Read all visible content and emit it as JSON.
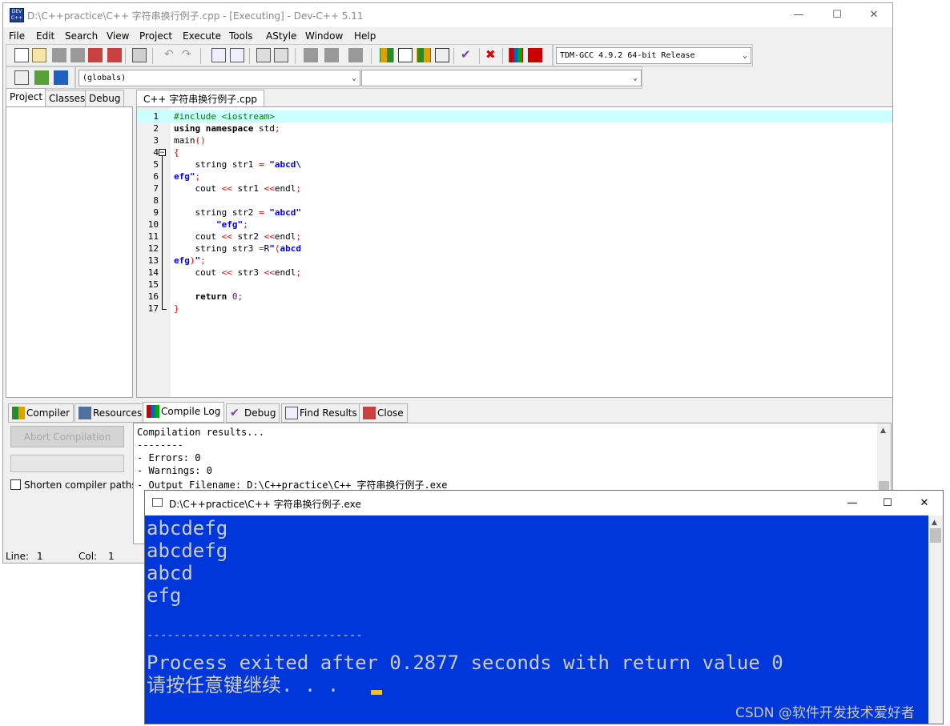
{
  "ide": {
    "title": "D:\\C++practice\\C++ 字符串换行例子.cpp - [Executing] - Dev-C++ 5.11",
    "menu": [
      "File",
      "Edit",
      "Search",
      "View",
      "Project",
      "Execute",
      "Tools",
      "AStyle",
      "Window",
      "Help"
    ],
    "compiler_select": "TDM-GCC 4.9.2 64-bit Release",
    "scope_select": "(globals)",
    "left_tabs": [
      "Project",
      "Classes",
      "Debug"
    ],
    "editor_tab": "C++ 字符串换行例子.cpp",
    "line_numbers": [
      "1",
      "2",
      "3",
      "4",
      "5",
      "6",
      "7",
      "8",
      "9",
      "10",
      "11",
      "12",
      "13",
      "14",
      "15",
      "16",
      "17"
    ],
    "bottom_tabs": [
      "Compiler",
      "Resources",
      "Compile Log",
      "Debug",
      "Find Results",
      "Close"
    ],
    "abort_label": "Abort Compilation",
    "shorten_label": "Shorten compiler paths",
    "log_lines": [
      "Compilation results...",
      "--------",
      "- Errors: 0",
      "- Warnings: 0",
      "- Output Filename: D:\\C++practice\\C++ 字符串换行例子.exe"
    ],
    "status": {
      "line_label": "Line:",
      "line_value": "1",
      "col_label": "Col:",
      "col_value": "1"
    }
  },
  "console": {
    "title": "D:\\C++practice\\C++ 字符串换行例子.exe",
    "lines": [
      "abcdefg",
      "abcdefg",
      "abcd",
      "efg",
      "",
      "--------------------------------",
      "Process exited after 0.2877 seconds with return value 0",
      "请按任意键继续. . ."
    ],
    "bg_color": "#0037da",
    "text_color": "#cccccc"
  },
  "watermark": "CSDN @软件开发技术爱好者"
}
